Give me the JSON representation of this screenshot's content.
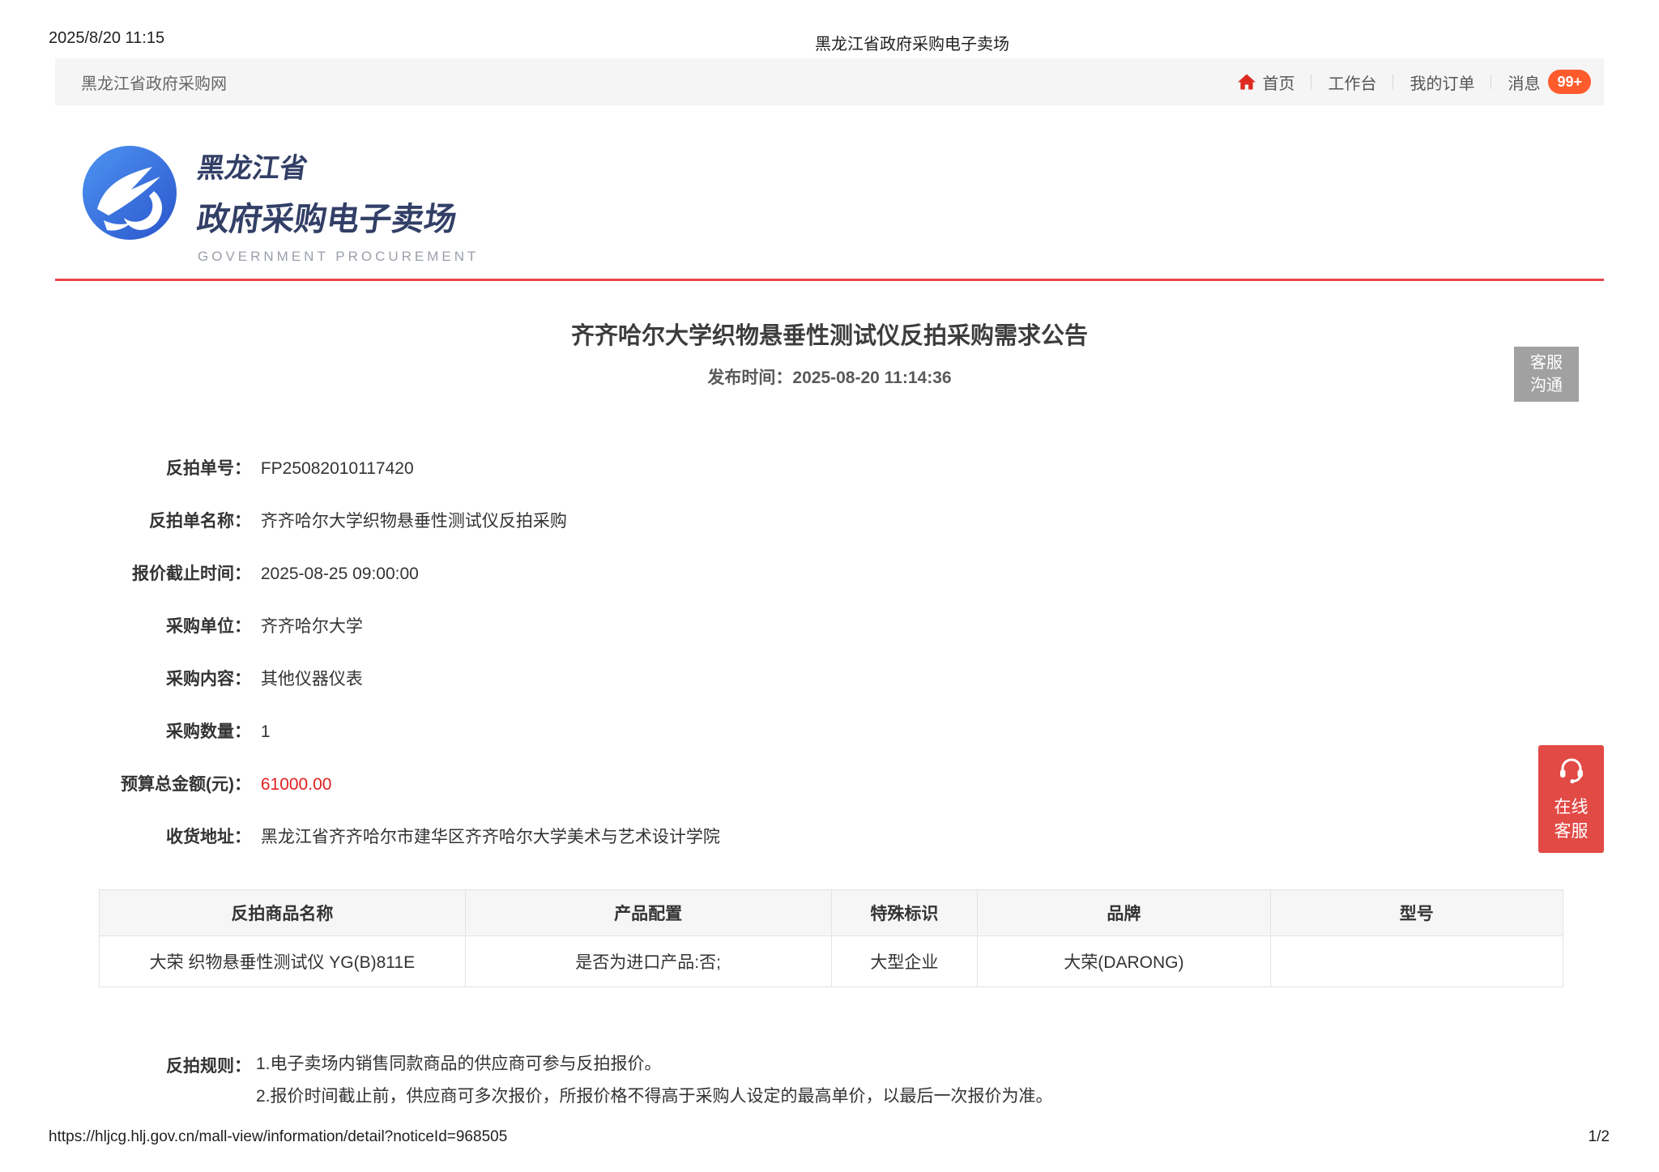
{
  "print_header": {
    "datetime": "2025/8/20 11:15",
    "doc_title": "黑龙江省政府采购电子卖场"
  },
  "print_footer": {
    "url": "https://hljcg.hlj.gov.cn/mall-view/information/detail?noticeId=968505",
    "page": "1/2"
  },
  "navbar": {
    "site_name": "黑龙江省政府采购网",
    "home": "首页",
    "workbench": "工作台",
    "orders": "我的订单",
    "messages": "消息",
    "badge": "99+"
  },
  "logo": {
    "line1": "黑龙江省",
    "line2": "政府采购电子卖场",
    "subtitle": "GOVERNMENT PROCUREMENT"
  },
  "notice": {
    "title": "齐齐哈尔大学织物悬垂性测试仪反拍采购需求公告",
    "publish_label": "发布时间：",
    "publish_time": "2025-08-20 11:14:36"
  },
  "chat_button": {
    "line1": "客服",
    "line2": "沟通"
  },
  "online_service": {
    "line1": "在线",
    "line2": "客服"
  },
  "fields": [
    {
      "label": "反拍单号：",
      "value": "FP25082010117420"
    },
    {
      "label": "反拍单名称：",
      "value": "齐齐哈尔大学织物悬垂性测试仪反拍采购"
    },
    {
      "label": "报价截止时间：",
      "value": "2025-08-25 09:00:00"
    },
    {
      "label": "采购单位：",
      "value": "齐齐哈尔大学"
    },
    {
      "label": "采购内容：",
      "value": "其他仪器仪表"
    },
    {
      "label": "采购数量：",
      "value": "1"
    },
    {
      "label": "预算总金额(元)：",
      "value": "61000.00"
    },
    {
      "label": "收货地址：",
      "value": "黑龙江省齐齐哈尔市建华区齐齐哈尔大学美术与艺术设计学院"
    }
  ],
  "table": {
    "headers": [
      "反拍商品名称",
      "产品配置",
      "特殊标识",
      "品牌",
      "型号"
    ],
    "rows": [
      [
        "大荣 织物悬垂性测试仪 YG(B)811E",
        "是否为进口产品:否;",
        "大型企业",
        "大荣(DARONG)",
        ""
      ]
    ]
  },
  "rules": {
    "label": "反拍规则：",
    "line1": "1.电子卖场内销售同款商品的供应商可参与反拍报价。",
    "line2": "2.报价时间截止前，供应商可多次报价，所报价格不得高于采购人设定的最高单价，以最后一次报价为准。"
  },
  "colors": {
    "accent_red": "#e8474a",
    "budget_red": "#e02020",
    "badge_orange": "#ff5b2d",
    "home_icon_red": "#dd2b20",
    "online_service_red": "#e14a45",
    "chat_button_gray": "#a1a1a1",
    "logo_blue_light": "#4e94f2",
    "logo_blue_dark": "#2a55cc",
    "logo_text_navy": "#323f66"
  }
}
